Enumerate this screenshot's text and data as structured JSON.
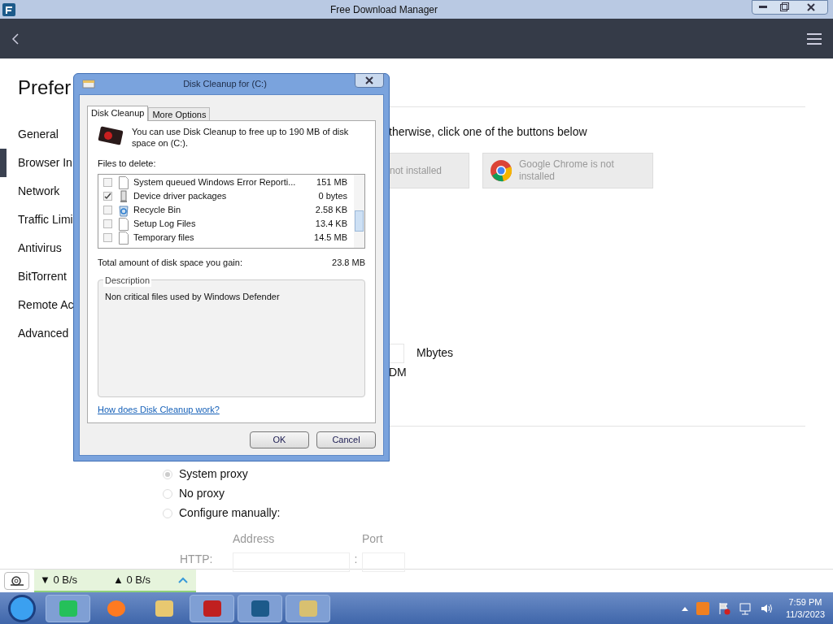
{
  "window": {
    "title": "Free Download Manager"
  },
  "preferences": {
    "heading": "Prefer",
    "nav": [
      {
        "label": "General",
        "selected": false
      },
      {
        "label": "Browser In",
        "selected": true
      },
      {
        "label": "Network",
        "selected": false
      },
      {
        "label": "Traffic Limi",
        "selected": false
      },
      {
        "label": "Antivirus",
        "selected": false
      },
      {
        "label": "BitTorrent",
        "selected": false
      },
      {
        "label": "Remote Ac",
        "selected": false
      },
      {
        "label": "Advanced",
        "selected": false
      }
    ],
    "intro": "therwise, click one of the buttons below",
    "browser_buttons": [
      {
        "kind": "plain",
        "label": "not installed"
      },
      {
        "kind": "chrome",
        "label": "Google Chrome is not installed"
      }
    ],
    "size_unit": "Mbytes",
    "option_fragment": "DM",
    "proxy_options": [
      {
        "label": "System proxy",
        "selected": true
      },
      {
        "label": "No proxy",
        "selected": false
      },
      {
        "label": "Configure manually:",
        "selected": false
      }
    ],
    "proxy_table": {
      "address_header": "Address",
      "port_header": "Port",
      "row_label": "HTTP:",
      "separator": ":"
    }
  },
  "status_bar": {
    "download": "▼ 0 B/s",
    "upload": "▲ 0 B/s"
  },
  "dialog": {
    "title": "Disk Cleanup for  (C:)",
    "tabs": [
      {
        "label": "Disk Cleanup",
        "selected": true
      },
      {
        "label": "More Options",
        "selected": false
      }
    ],
    "message": "You can use Disk Cleanup to free up to 190 MB of disk space on  (C:).",
    "files_label": "Files to delete:",
    "files": [
      {
        "name": "System queued Windows Error Reporti...",
        "size": "151 MB",
        "checked": false,
        "kind": "file"
      },
      {
        "name": "Device driver packages",
        "size": "0 bytes",
        "checked": true,
        "kind": "driver"
      },
      {
        "name": "Recycle Bin",
        "size": "2.58 KB",
        "checked": false,
        "kind": "bin"
      },
      {
        "name": "Setup Log Files",
        "size": "13.4 KB",
        "checked": false,
        "kind": "file"
      },
      {
        "name": "Temporary files",
        "size": "14.5 MB",
        "checked": false,
        "kind": "file"
      }
    ],
    "total_label": "Total amount of disk space you gain:",
    "total_value": "23.8 MB",
    "description_label": "Description",
    "description": "Non critical files used by Windows Defender",
    "help_link": "How does Disk Cleanup work?",
    "buttons": [
      "OK",
      "Cancel"
    ]
  },
  "taskbar": {
    "time": "7:59 PM",
    "date": "11/3/2023"
  }
}
